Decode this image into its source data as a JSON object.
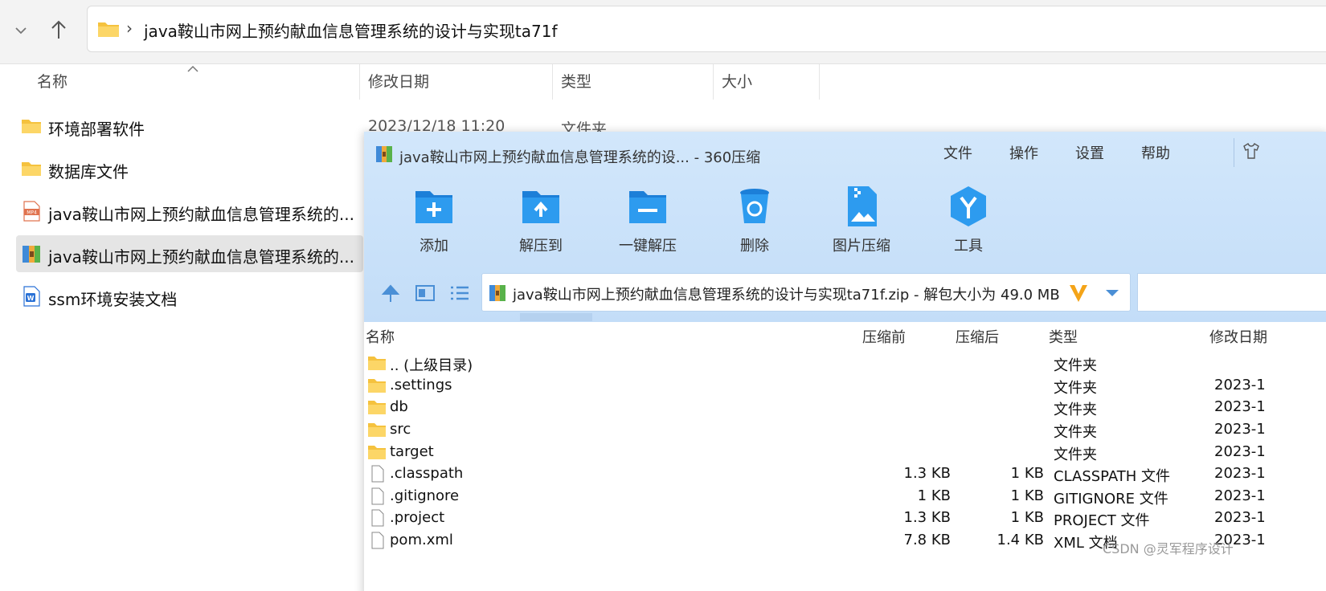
{
  "explorer": {
    "address_path": "java鞍山市网上预约献血信息管理系统的设计与实现ta71f",
    "breadcrumb_separator": "›",
    "columns": [
      "名称",
      "修改日期",
      "类型",
      "大小"
    ],
    "items": [
      {
        "name": "环境部署软件",
        "icon": "folder-icon"
      },
      {
        "name": "数据库文件",
        "icon": "folder-icon"
      },
      {
        "name": "java鞍山市网上预约献血信息管理系统的...",
        "icon": "mp4-file-icon"
      },
      {
        "name": "java鞍山市网上预约献血信息管理系统的...",
        "icon": "zip-archive-icon"
      },
      {
        "name": "ssm环境安装文档",
        "icon": "word-doc-icon"
      }
    ],
    "first_row_date": "2023/12/18 11:20",
    "first_row_type": "文件夹"
  },
  "zip": {
    "title": "java鞍山市网上预约献血信息管理系统的设... - 360压缩",
    "menu": [
      "文件",
      "操作",
      "设置",
      "帮助"
    ],
    "tools": [
      {
        "label": "添加",
        "icon": "add-folder-icon"
      },
      {
        "label": "解压到",
        "icon": "extract-to-icon"
      },
      {
        "label": "一键解压",
        "icon": "one-click-extract-icon"
      },
      {
        "label": "删除",
        "icon": "delete-icon"
      },
      {
        "label": "图片压缩",
        "icon": "image-compress-icon"
      },
      {
        "label": "工具",
        "icon": "tools-icon"
      }
    ],
    "path_text": "java鞍山市网上预约献血信息管理系统的设计与实现ta71f.zip - 解包大小为 49.0 MB",
    "columns": [
      "名称",
      "压缩前",
      "压缩后",
      "类型",
      "修改日期"
    ],
    "rows": [
      {
        "name": ".. (上级目录)",
        "before": "",
        "after": "",
        "type": "文件夹",
        "date": "",
        "icon": "folder-icon"
      },
      {
        "name": ".settings",
        "before": "",
        "after": "",
        "type": "文件夹",
        "date": "2023-1",
        "icon": "folder-icon"
      },
      {
        "name": "db",
        "before": "",
        "after": "",
        "type": "文件夹",
        "date": "2023-1",
        "icon": "folder-icon"
      },
      {
        "name": "src",
        "before": "",
        "after": "",
        "type": "文件夹",
        "date": "2023-1",
        "icon": "folder-icon"
      },
      {
        "name": "target",
        "before": "",
        "after": "",
        "type": "文件夹",
        "date": "2023-1",
        "icon": "folder-icon"
      },
      {
        "name": ".classpath",
        "before": "1.3 KB",
        "after": "1 KB",
        "type": "CLASSPATH 文件",
        "date": "2023-1",
        "icon": "file-icon"
      },
      {
        "name": ".gitignore",
        "before": "1 KB",
        "after": "1 KB",
        "type": "GITIGNORE 文件",
        "date": "2023-1",
        "icon": "file-icon"
      },
      {
        "name": ".project",
        "before": "1.3 KB",
        "after": "1 KB",
        "type": "PROJECT 文件",
        "date": "2023-1",
        "icon": "file-icon"
      },
      {
        "name": "pom.xml",
        "before": "7.8 KB",
        "after": "1.4 KB",
        "type": "XML 文档",
        "date": "2023-1",
        "icon": "file-icon"
      }
    ]
  },
  "watermark": "CSDN @灵军程序设计",
  "colors": {
    "folder": "#f5c23e",
    "zip_header_bg": "#cfe4fa",
    "tool_blue": "#1e8fe6",
    "selected_row": "#e5e5e5"
  }
}
